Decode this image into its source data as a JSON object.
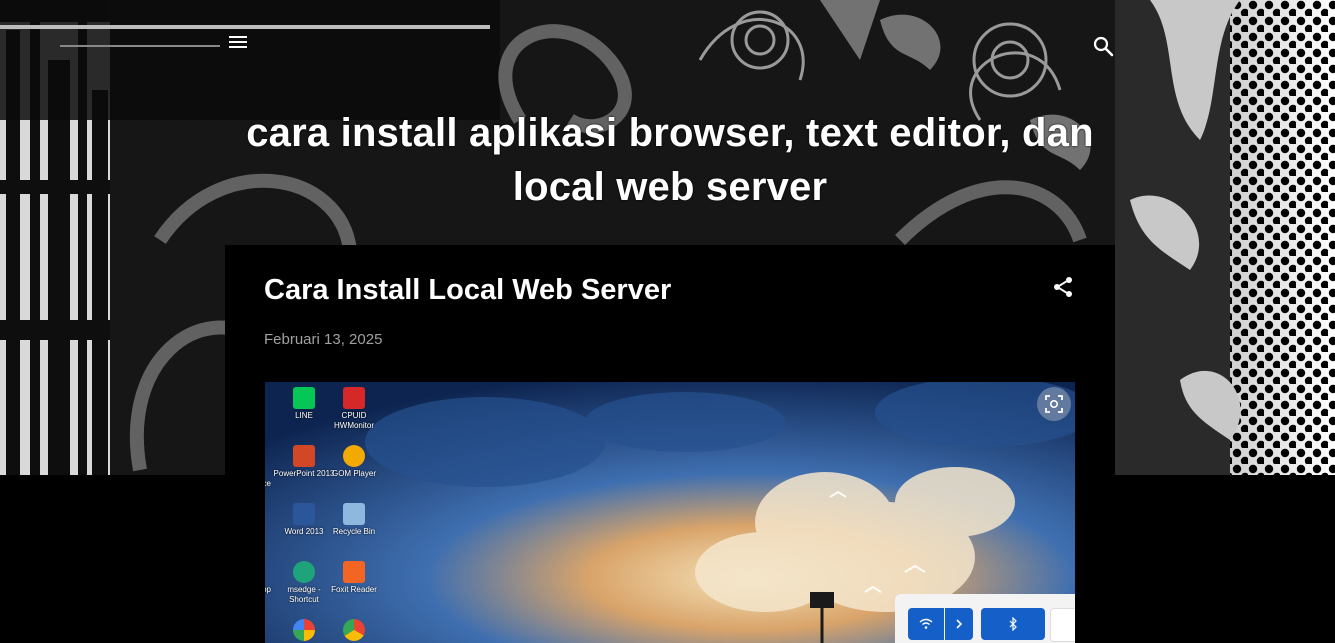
{
  "header": {
    "menu_icon": "hamburger-menu-icon",
    "search_icon": "search-icon",
    "blog_title": "cara install aplikasi browser, text editor, dan local web server"
  },
  "post": {
    "title": "Cara Install Local Web Server",
    "date": "Februari 13, 2025",
    "share_icon": "share-icon",
    "image": {
      "lens_icon": "visual-search-icon",
      "desktop_icons": [
        {
          "label": "LINE",
          "color": "#06c755"
        },
        {
          "label": "CPUID HWMonitor",
          "color": "#d62828"
        },
        {
          "label": "PowerPoint 2013",
          "color": "#d24726"
        },
        {
          "label": "GOM Player",
          "color": "#f2a900"
        },
        {
          "label": "Word 2013",
          "color": "#2b579a"
        },
        {
          "label": "Recycle Bin",
          "color": "#8fb8de"
        },
        {
          "label": "msedge - Shortcut",
          "color": "#1fa37a"
        },
        {
          "label": "Foxit Reader",
          "color": "#f26522"
        }
      ],
      "edge_fragments": [
        "ce",
        "op"
      ],
      "quick_settings": {
        "wifi_icon": "wifi-icon",
        "chevron_icon": "chevron-right-icon",
        "bluetooth_icon": "bluetooth-icon"
      }
    }
  }
}
